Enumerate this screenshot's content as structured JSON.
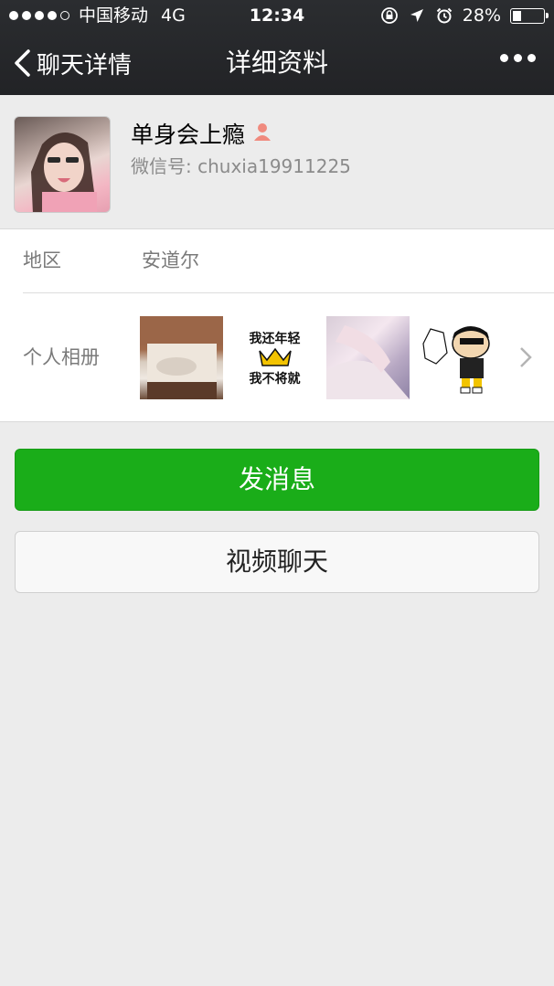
{
  "status_bar": {
    "carrier": "中国移动",
    "network": "4G",
    "time": "12:34",
    "battery": "28%",
    "battery_level": 0.28,
    "signal_bars_filled": 4,
    "signal_bars_total": 5
  },
  "nav": {
    "back_label": "聊天详情",
    "title": "详细资料"
  },
  "profile": {
    "nickname": "单身会上瘾",
    "wechat_id": "微信号: chuxia19911225"
  },
  "info": {
    "region_label": "地区",
    "region_value": "安道尔",
    "album_label": "个人相册",
    "album_thumb_text": [
      "我还年轻",
      "我不将就"
    ]
  },
  "actions": {
    "send_message": "发消息",
    "video_call": "视频聊天"
  },
  "colors": {
    "nav_bg": "#252629",
    "accent_green": "#1aad19",
    "page_bg": "#ececec"
  },
  "icons": [
    "back-arrow-icon",
    "more-icon",
    "person-icon",
    "location-icon",
    "alarm-icon",
    "chevron-right-icon"
  ]
}
